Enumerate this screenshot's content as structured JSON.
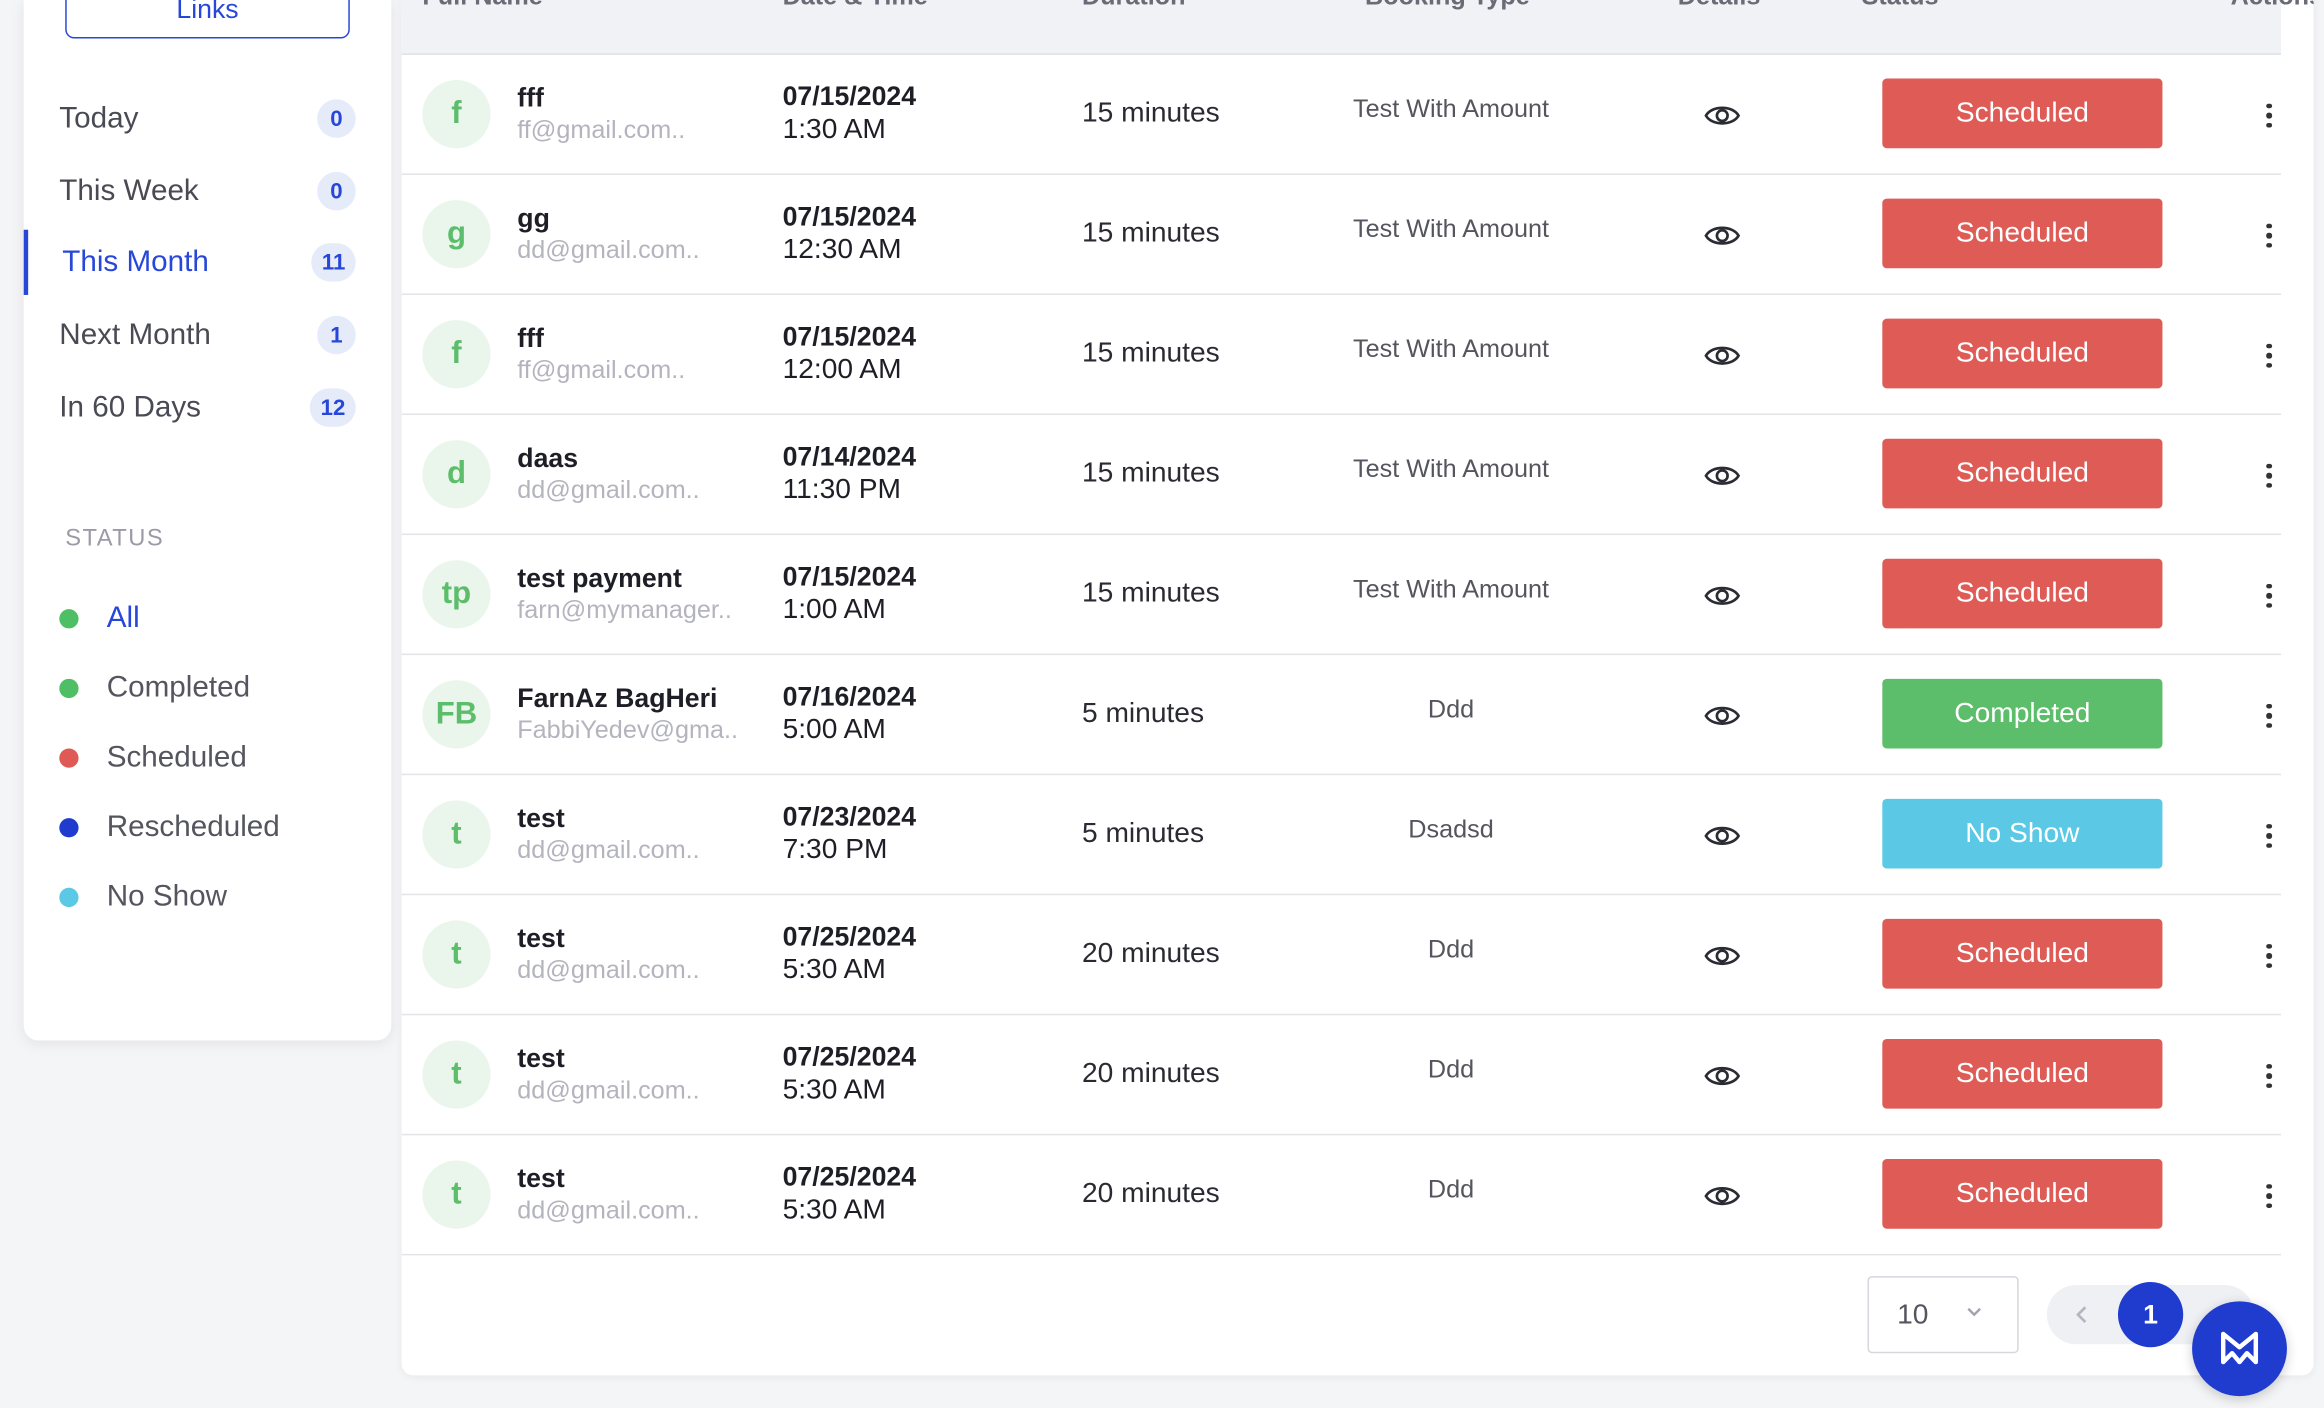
{
  "sidebar": {
    "links_label": "Links",
    "periods": [
      {
        "label": "Today",
        "count": "0"
      },
      {
        "label": "This Week",
        "count": "0"
      },
      {
        "label": "This Month",
        "count": "11"
      },
      {
        "label": "Next Month",
        "count": "1"
      },
      {
        "label": "In 60 Days",
        "count": "12"
      }
    ],
    "active_period": "This Month",
    "status_heading": "STATUS",
    "statuses": [
      {
        "label": "All",
        "color": "#4fbf65"
      },
      {
        "label": "Completed",
        "color": "#4fbf65"
      },
      {
        "label": "Scheduled",
        "color": "#e05a55"
      },
      {
        "label": "Rescheduled",
        "color": "#1f3ccf"
      },
      {
        "label": "No Show",
        "color": "#5bc8e6"
      }
    ],
    "active_status": "All"
  },
  "table": {
    "headers": {
      "full_name": "Full Name",
      "date_time": "Date & Time",
      "duration": "Duration",
      "booking_type": "Booking Type",
      "details": "Details",
      "status": "Status",
      "actions": "Actions"
    },
    "rows": [
      {
        "initials": "f",
        "name": "fff",
        "email": "ff@gmail.com..",
        "date": "07/15/2024",
        "time": "1:30 AM",
        "duration": "15 minutes",
        "booking_type": "Test With Amount",
        "status": "Scheduled"
      },
      {
        "initials": "g",
        "name": "gg",
        "email": "dd@gmail.com..",
        "date": "07/15/2024",
        "time": "12:30 AM",
        "duration": "15 minutes",
        "booking_type": "Test With Amount",
        "status": "Scheduled"
      },
      {
        "initials": "f",
        "name": "fff",
        "email": "ff@gmail.com..",
        "date": "07/15/2024",
        "time": "12:00 AM",
        "duration": "15 minutes",
        "booking_type": "Test With Amount",
        "status": "Scheduled"
      },
      {
        "initials": "d",
        "name": "daas",
        "email": "dd@gmail.com..",
        "date": "07/14/2024",
        "time": "11:30 PM",
        "duration": "15 minutes",
        "booking_type": "Test With Amount",
        "status": "Scheduled"
      },
      {
        "initials": "tp",
        "name": "test payment",
        "email": "farn@mymanager..",
        "date": "07/15/2024",
        "time": "1:00 AM",
        "duration": "15 minutes",
        "booking_type": "Test With Amount",
        "status": "Scheduled"
      },
      {
        "initials": "FB",
        "name": "FarnAz BagHeri",
        "email": "FabbiYedev@gma..",
        "date": "07/16/2024",
        "time": "5:00 AM",
        "duration": "5 minutes",
        "booking_type": "Ddd",
        "status": "Completed"
      },
      {
        "initials": "t",
        "name": "test",
        "email": "dd@gmail.com..",
        "date": "07/23/2024",
        "time": "7:30 PM",
        "duration": "5 minutes",
        "booking_type": "Dsadsd",
        "status": "No Show"
      },
      {
        "initials": "t",
        "name": "test",
        "email": "dd@gmail.com..",
        "date": "07/25/2024",
        "time": "5:30 AM",
        "duration": "20 minutes",
        "booking_type": "Ddd",
        "status": "Scheduled"
      },
      {
        "initials": "t",
        "name": "test",
        "email": "dd@gmail.com..",
        "date": "07/25/2024",
        "time": "5:30 AM",
        "duration": "20 minutes",
        "booking_type": "Ddd",
        "status": "Scheduled"
      },
      {
        "initials": "t",
        "name": "test",
        "email": "dd@gmail.com..",
        "date": "07/25/2024",
        "time": "5:30 AM",
        "duration": "20 minutes",
        "booking_type": "Ddd",
        "status": "Scheduled"
      }
    ]
  },
  "status_colors": {
    "Scheduled": "#de5b56",
    "Completed": "#5cbd6b",
    "No Show": "#5bc8e6"
  },
  "footer": {
    "per_page": "10",
    "current_page": "1"
  },
  "icons": {
    "details": "eye-icon",
    "actions": "kebab-menu-icon",
    "per_page_toggle": "chevron-down-icon",
    "prev_page": "chevron-left-icon",
    "fab": "app-logo-icon"
  }
}
